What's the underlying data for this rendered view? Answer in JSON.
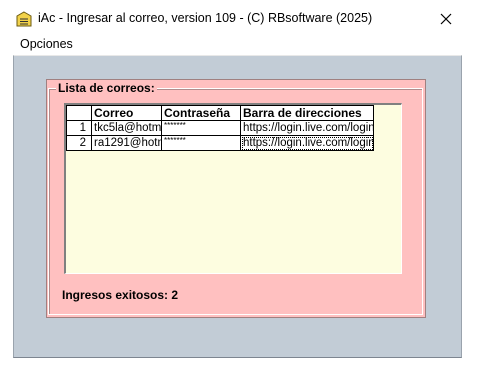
{
  "window": {
    "title": "iAc - Ingresar al correo, version 109 - (C) RBsoftware (2025)",
    "close_glyph": "✕",
    "app_icon": "stacked-document-icon"
  },
  "menu": {
    "items": [
      {
        "label": "Opciones"
      }
    ]
  },
  "group": {
    "label": "Lista de correos:"
  },
  "grid": {
    "headers": [
      "",
      "Correo",
      "Contraseña",
      "Barra de direcciones"
    ],
    "rows": [
      {
        "num": "1",
        "email": "tkc5la@hotma",
        "password": "*******",
        "url": "https://login.live.com/login"
      },
      {
        "num": "2",
        "email": "ra1291@hotm",
        "password": "*******",
        "url": "https://login.live.com/login"
      }
    ]
  },
  "status": {
    "text": "Ingresos exitosos: 2"
  },
  "colors": {
    "panel_bg": "#ffc0c0",
    "client_bg": "#c2ccd6",
    "grid_bg": "#fdfde0"
  }
}
